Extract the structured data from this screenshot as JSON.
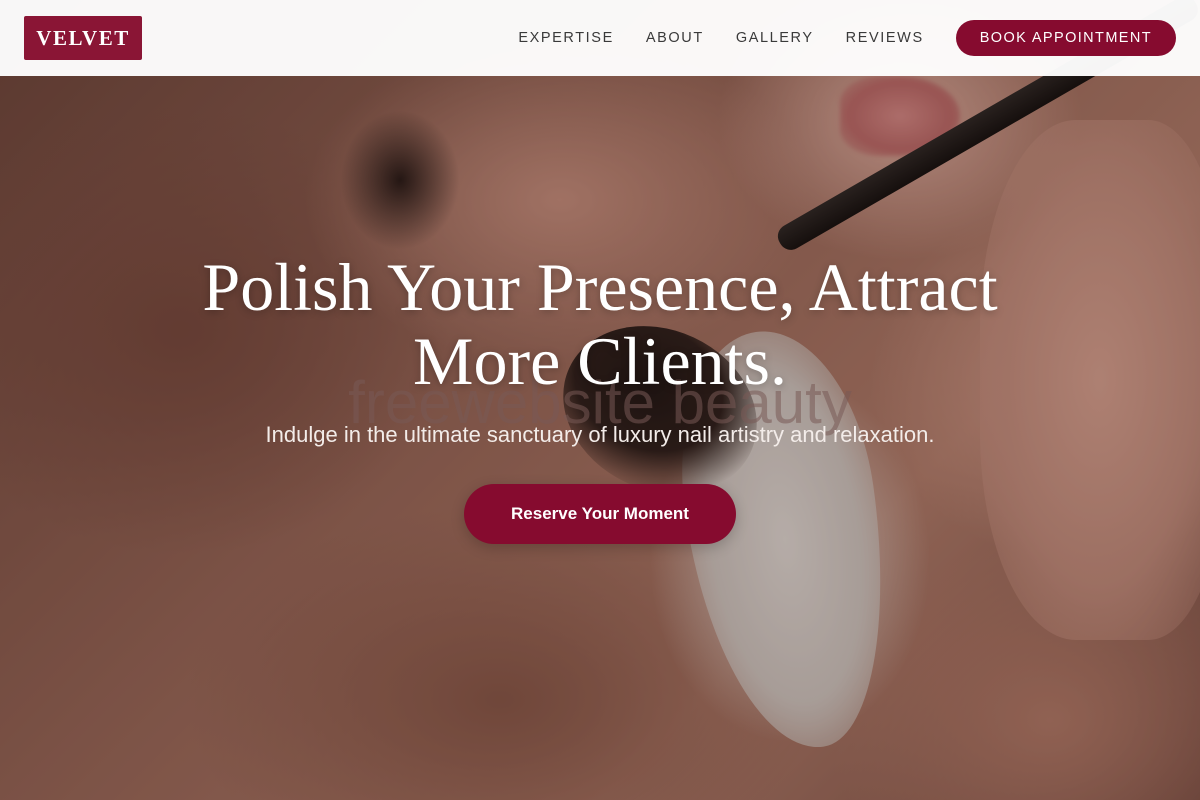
{
  "brand": {
    "logo_text": "VELVET",
    "accent_color": "#860b2f"
  },
  "nav": {
    "links": [
      {
        "label": "EXPERTISE"
      },
      {
        "label": "ABOUT"
      },
      {
        "label": "GALLERY"
      },
      {
        "label": "REVIEWS"
      }
    ],
    "book_label": "BOOK APPOINTMENT"
  },
  "hero": {
    "headline_line1": "Polish Your Presence, Attract",
    "headline_line2": "More Clients.",
    "subtext": "Indulge in the ultimate sanctuary of luxury nail artistry and relaxation.",
    "cta_label": "Reserve Your Moment",
    "watermark": "freewebsite beauty"
  }
}
